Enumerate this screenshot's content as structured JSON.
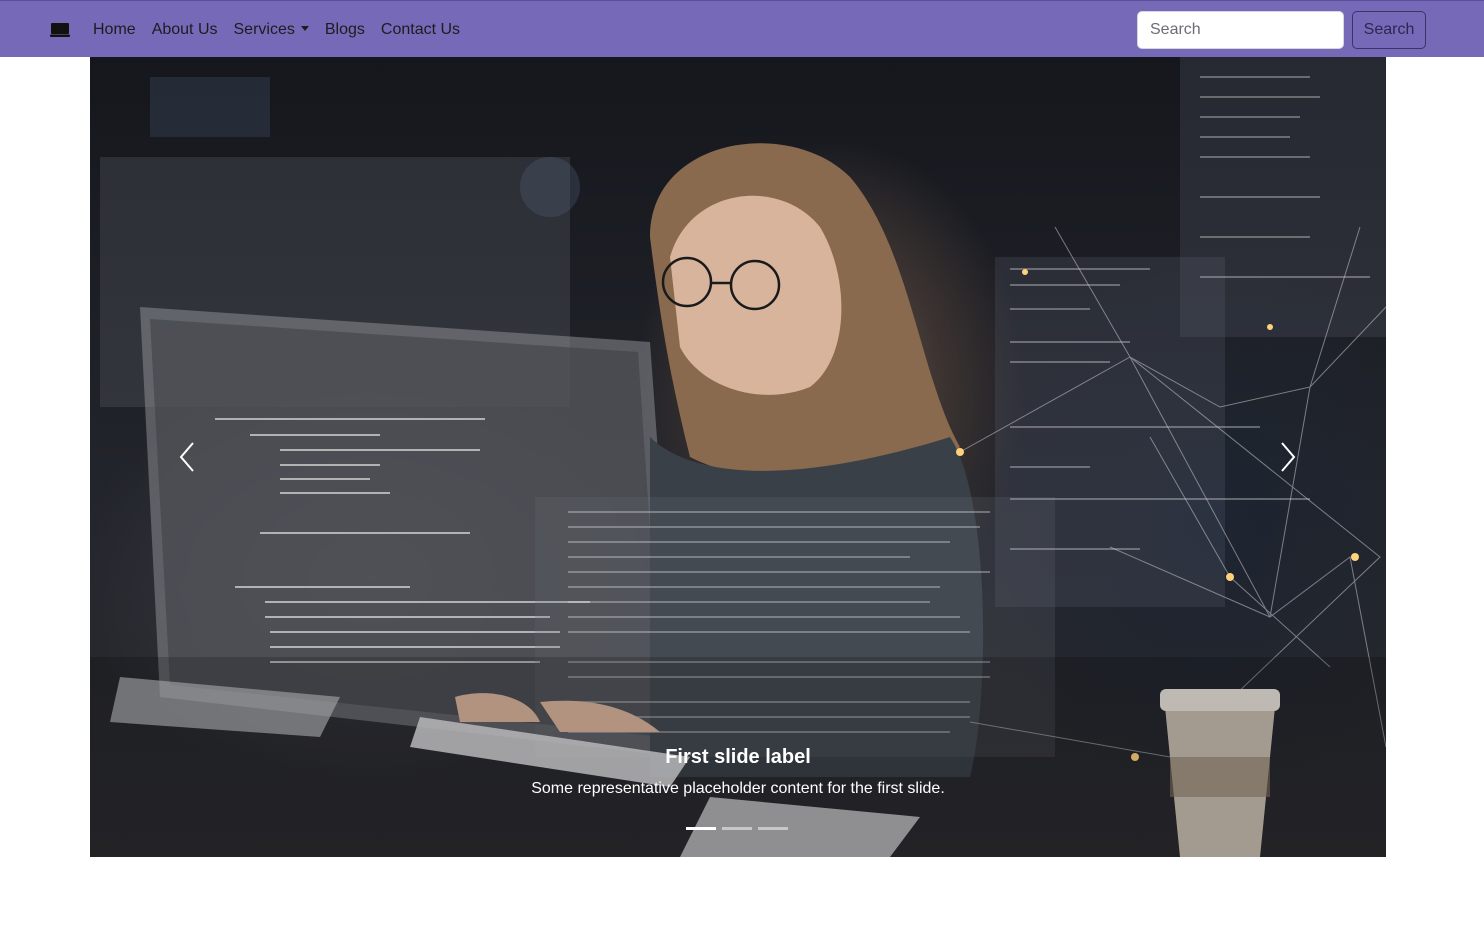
{
  "navbar": {
    "brand_icon": "laptop-icon",
    "links": {
      "home": "Home",
      "about": "About Us",
      "services": "Services",
      "blogs": "Blogs",
      "contact": "Contact Us"
    },
    "search": {
      "placeholder": "Search",
      "button_label": "Search"
    },
    "colors": {
      "background": "#7569b8"
    }
  },
  "carousel": {
    "slide_image": "woman-coding-at-computer-photo",
    "caption_title": "First slide label",
    "caption_text": "Some representative placeholder content for the first slide.",
    "indicators_count": 3,
    "active_indicator": 1,
    "prev_icon": "chevron-left-icon",
    "next_icon": "chevron-right-icon"
  }
}
